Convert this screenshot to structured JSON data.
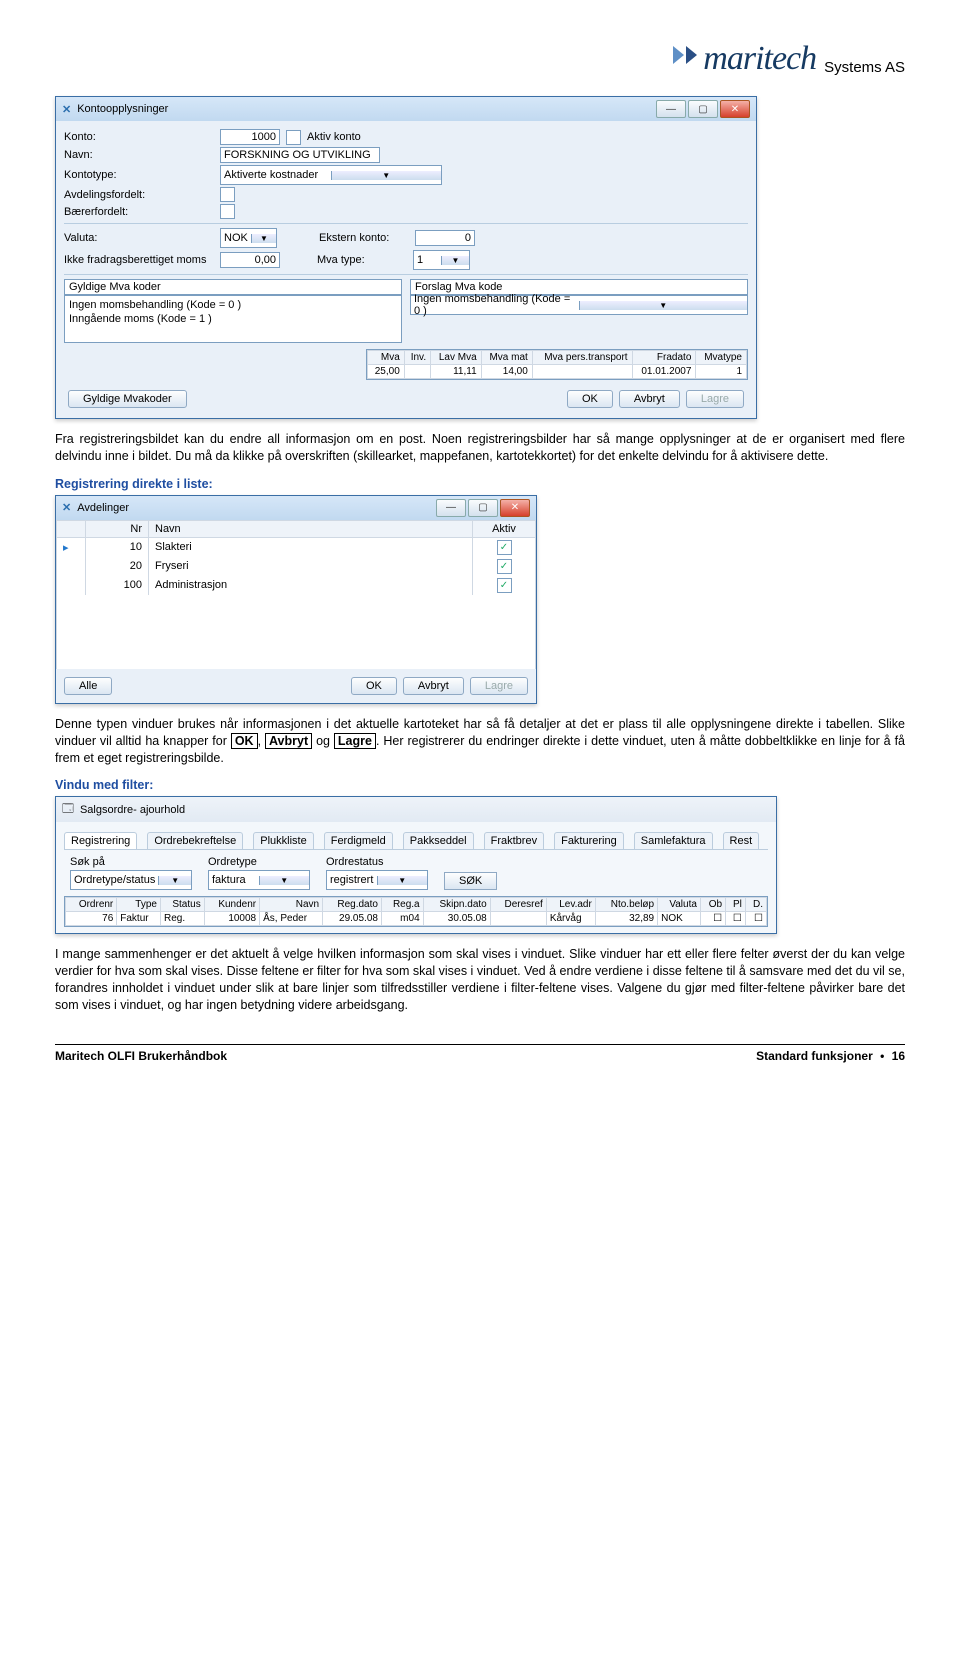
{
  "header": {
    "brand": "maritech",
    "suffix": "Systems AS"
  },
  "win1": {
    "title": "Kontoopplysninger",
    "labels": {
      "konto": "Konto:",
      "aktiv": "Aktiv konto",
      "navn": "Navn:",
      "kontotype": "Kontotype:",
      "avd": "Avdelingsfordelt:",
      "baer": "Bærerfordelt:",
      "valuta": "Valuta:",
      "ekstern": "Ekstern konto:",
      "ikkefrad": "Ikke fradragsberettiget moms",
      "mvatype": "Mva type:",
      "gyldige": "Gyldige Mva koder",
      "forslag": "Forslag Mva kode"
    },
    "values": {
      "konto": "1000",
      "navn": "FORSKNING OG UTVIKLING",
      "kontotype": "Aktiverte kostnader",
      "valuta": "NOK",
      "ekstern": "0",
      "ikkefrad": "0,00",
      "mvatype": "1",
      "gyldige": [
        "Ingen momsbehandling  (Kode = 0 )",
        "Inngående moms  (Kode = 1 )"
      ],
      "forslag": "Ingen momsbehandling  (Kode = 0 )"
    },
    "gridcols": [
      "Mva",
      "Inv.",
      "Lav Mva",
      "Mva mat",
      "Mva pers.transport",
      "Fradato",
      "Mvatype"
    ],
    "gridrow": [
      "25,00",
      "",
      "11,11",
      "14,00",
      "",
      "01.01.2007",
      "1"
    ],
    "buttons": {
      "gmk": "Gyldige Mvakoder",
      "ok": "OK",
      "avbryt": "Avbryt",
      "lagre": "Lagre"
    }
  },
  "para1a": "Fra registreringsbildet kan du endre all informasjon om en post. Noen registreringsbilder har så mange opplysninger at de er organisert med flere delvindu inne i bildet. Du må da klikke på overskriften (skillearket, mappefanen, kartotekkortet) for det enkelte delvindu for å aktivisere dette.",
  "h1": "Registrering direkte i liste:",
  "win2": {
    "title": "Avdelinger",
    "cols": {
      "nr": "Nr",
      "navn": "Navn",
      "aktiv": "Aktiv"
    },
    "rows": [
      {
        "nr": "10",
        "navn": "Slakteri",
        "aktiv": true
      },
      {
        "nr": "20",
        "navn": "Fryseri",
        "aktiv": true
      },
      {
        "nr": "100",
        "navn": "Administrasjon",
        "aktiv": true
      }
    ],
    "alle": "Alle",
    "buttons": {
      "ok": "OK",
      "avbryt": "Avbryt",
      "lagre": "Lagre"
    }
  },
  "para2a": "Denne typen vinduer brukes når informasjonen i det aktuelle kartoteket har så få detaljer at det er plass til alle opplysningene direkte i tabellen. Slike vinduer vil alltid ha knapper for ",
  "kw": {
    "ok": "OK",
    "avbryt": "Avbryt",
    "lagre": "Lagre"
  },
  "para2b": " og ",
  "para2c": ". Her registrerer du endringer direkte i dette vinduet, uten å måtte dobbeltklikke en linje for å få frem et eget registreringsbilde.",
  "h2": "Vindu med filter:",
  "win3": {
    "title": "Salgsordre- ajourhold",
    "tabs": [
      "Registrering",
      "Ordrebekreftelse",
      "Plukkliste",
      "Ferdigmeld",
      "Pakkseddel",
      "Fraktbrev",
      "Fakturering",
      "Samlefaktura",
      "Rest"
    ],
    "fl": {
      "sokpa": "Søk på",
      "ordretype": "Ordretype",
      "ordrestatus": "Ordrestatus"
    },
    "fv": {
      "sokpa": "Ordretype/status",
      "ordretype": "faktura",
      "ordrestatus": "registrert",
      "sok": "SØK"
    },
    "gcols": [
      "Ordrenr",
      "Type",
      "Status",
      "Kundenr",
      "Navn",
      "Reg.dato",
      "Reg.a",
      "Skipn.dato",
      "Deresref",
      "Lev.adr",
      "Nto.beløp",
      "Valuta",
      "Ob",
      "Pl",
      "D."
    ],
    "grow": [
      "76",
      "Faktur",
      "Reg.",
      "10008",
      "Ås, Peder",
      "29.05.08",
      "m04",
      "30.05.08",
      "",
      "Kårvåg",
      "32,89",
      "NOK",
      "",
      "",
      ""
    ]
  },
  "para3": "I mange sammenhenger er det aktuelt å velge hvilken informasjon som skal vises i vinduet. Slike vinduer har ett eller flere felter øverst der du kan velge verdier for hva som skal vises. Disse feltene er filter for hva som skal vises i vinduet. Ved å endre verdiene i disse feltene til å samsvare med det du vil se, forandres innholdet i vinduet under slik at bare linjer som tilfredsstiller verdiene i filter-feltene vises. Valgene du gjør med filter-feltene påvirker bare det som vises i vinduet, og har ingen betydning videre arbeidsgang.",
  "footer": {
    "left": "Maritech OLFI Brukerhåndbok",
    "right1": "Standard funksjoner",
    "right2": "16"
  }
}
